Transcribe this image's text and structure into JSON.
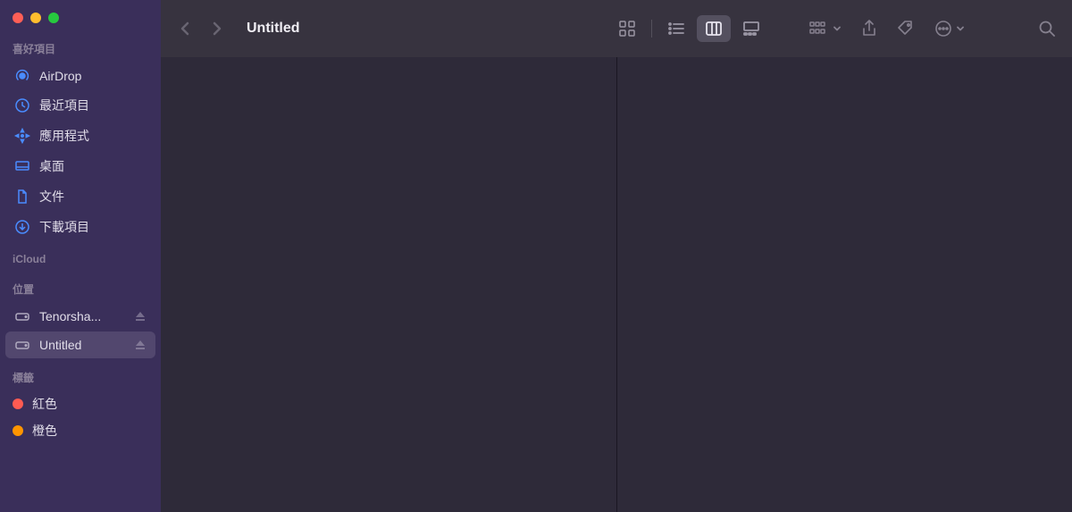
{
  "window": {
    "title": "Untitled"
  },
  "sidebar": {
    "sections": {
      "favorites": {
        "header": "喜好項目",
        "items": [
          {
            "label": "AirDrop",
            "icon": "airdrop"
          },
          {
            "label": "最近項目",
            "icon": "clock"
          },
          {
            "label": "應用程式",
            "icon": "apps"
          },
          {
            "label": "桌面",
            "icon": "desktop"
          },
          {
            "label": "文件",
            "icon": "document"
          },
          {
            "label": "下載項目",
            "icon": "download"
          }
        ]
      },
      "icloud": {
        "header": "iCloud"
      },
      "locations": {
        "header": "位置",
        "items": [
          {
            "label": "Tenorsha...",
            "icon": "disk",
            "ejectable": true,
            "selected": false
          },
          {
            "label": "Untitled",
            "icon": "disk",
            "ejectable": true,
            "selected": true
          }
        ]
      },
      "tags": {
        "header": "標籤",
        "items": [
          {
            "label": "紅色",
            "color": "#ff5b52"
          },
          {
            "label": "橙色",
            "color": "#ff9500"
          }
        ]
      }
    }
  },
  "colors": {
    "icon_blue": "#4a8cff",
    "icon_gray": "#c5c0d0"
  }
}
